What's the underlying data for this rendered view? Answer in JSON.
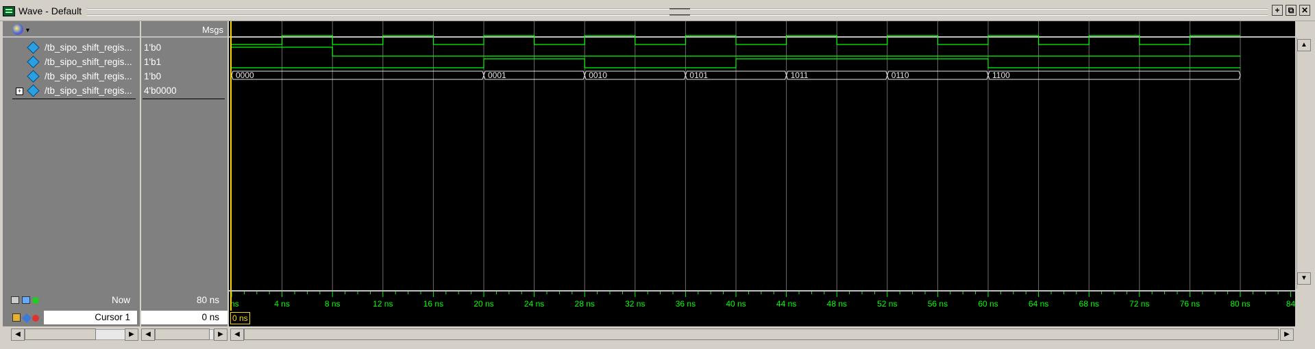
{
  "window": {
    "title": "Wave - Default"
  },
  "header": {
    "msgs_label": "Msgs"
  },
  "signals": [
    {
      "name": "/tb_sipo_shift_regis...",
      "value": "1'b0",
      "expandable": false
    },
    {
      "name": "/tb_sipo_shift_regis...",
      "value": "1'b1",
      "expandable": false
    },
    {
      "name": "/tb_sipo_shift_regis...",
      "value": "1'b0",
      "expandable": false
    },
    {
      "name": "/tb_sipo_shift_regis...",
      "value": "4'b0000",
      "expandable": true
    }
  ],
  "bus_values": [
    "0000",
    "0001",
    "0010",
    "0101",
    "1011",
    "0110",
    "1100"
  ],
  "timeline": {
    "now_label": "Now",
    "now_value": "80 ns",
    "cursor_label": "Cursor 1",
    "cursor_value": "0 ns",
    "cursor_marker": "0 ns",
    "tick_labels": [
      "4 ns",
      "8 ns",
      "12 ns",
      "16 ns",
      "20 ns",
      "24 ns",
      "28 ns",
      "32 ns",
      "36 ns",
      "40 ns",
      "44 ns",
      "48 ns",
      "52 ns",
      "56 ns",
      "60 ns",
      "64 ns",
      "68 ns",
      "72 ns",
      "76 ns",
      "80 ns",
      "84"
    ],
    "first_label": "ns"
  },
  "colors": {
    "wave": "#00ff00",
    "bus": "#e8e8e8",
    "cursor": "#ffd700",
    "grid": "#6e6e6e",
    "background": "#000000"
  },
  "chart_data": {
    "type": "line",
    "x_unit": "ns",
    "xlim": [
      0,
      84
    ],
    "series": [
      {
        "edges": [
          [
            0,
            0
          ],
          [
            4,
            1
          ],
          [
            8,
            0
          ],
          [
            12,
            1
          ],
          [
            16,
            0
          ],
          [
            20,
            1
          ],
          [
            24,
            0
          ],
          [
            28,
            1
          ],
          [
            32,
            0
          ],
          [
            36,
            1
          ],
          [
            40,
            0
          ],
          [
            44,
            1
          ],
          [
            48,
            0
          ],
          [
            52,
            1
          ],
          [
            56,
            0
          ],
          [
            60,
            1
          ],
          [
            64,
            0
          ],
          [
            68,
            1
          ],
          [
            72,
            0
          ],
          [
            76,
            1
          ],
          [
            80,
            1
          ]
        ]
      },
      {
        "edges": [
          [
            0,
            1
          ],
          [
            8,
            0
          ],
          [
            80,
            0
          ]
        ]
      },
      {
        "edges": [
          [
            0,
            0
          ],
          [
            20,
            1
          ],
          [
            28,
            0
          ],
          [
            40,
            1
          ],
          [
            60,
            0
          ],
          [
            80,
            0
          ]
        ]
      }
    ],
    "bus": {
      "segments": [
        [
          0,
          "0000"
        ],
        [
          20,
          "0001"
        ],
        [
          28,
          "0010"
        ],
        [
          36,
          "0101"
        ],
        [
          44,
          "1011"
        ],
        [
          52,
          "0110"
        ],
        [
          60,
          "1100"
        ]
      ],
      "end": 80
    }
  }
}
